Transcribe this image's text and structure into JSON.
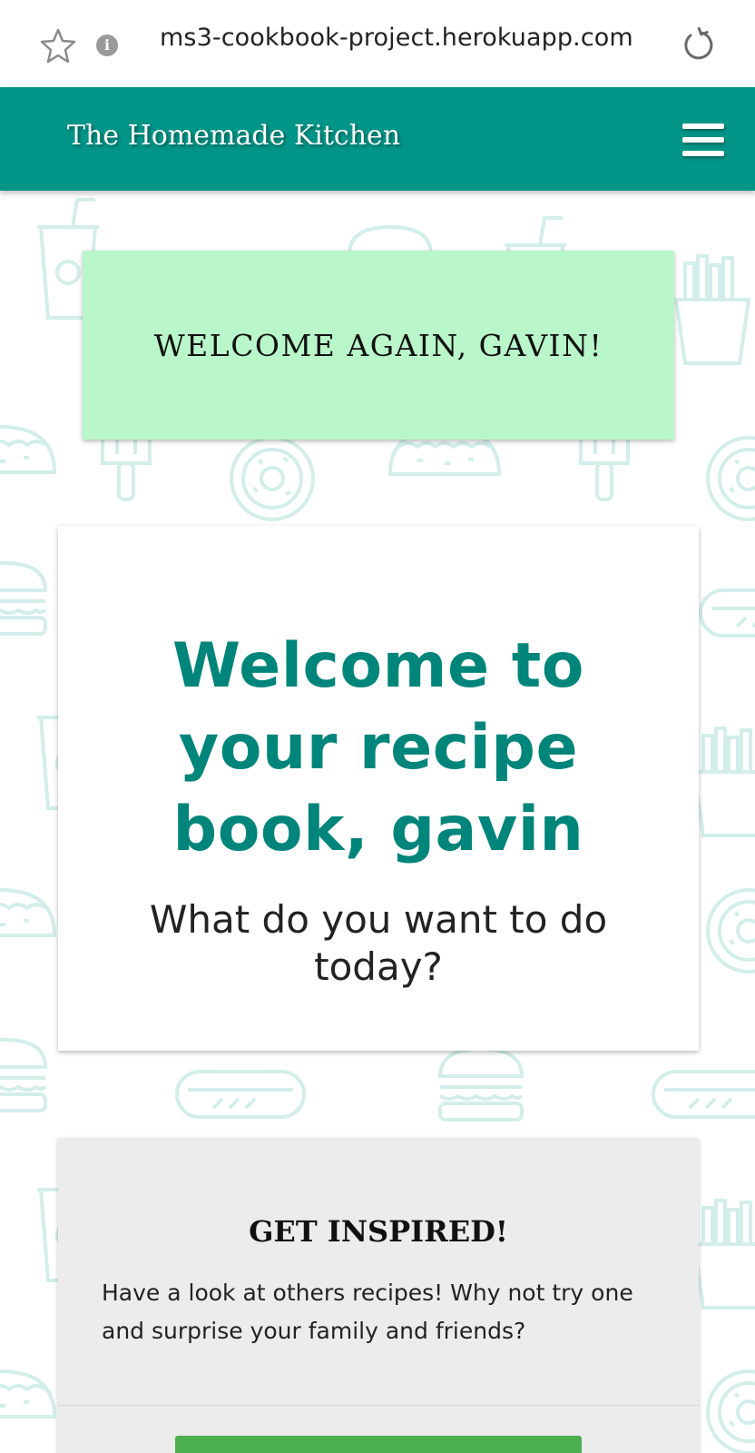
{
  "browser": {
    "url": "ms3-cookbook-project.herokuapp.com",
    "icons": [
      "star-icon",
      "info-icon",
      "reload-icon"
    ]
  },
  "navbar": {
    "brand": "The Homemade Kitchen",
    "menu_icon": "hamburger-menu-icon",
    "color": "#009587"
  },
  "welcome_banner": {
    "text": "WELCOME AGAIN, GAVIN!",
    "color": "#b9f6ca"
  },
  "welcome_card": {
    "heading": "Welcome to your recipe book, gavin",
    "subheading": "What do you want to do today?",
    "heading_color": "#00857a"
  },
  "inspire_card": {
    "title": "GET INSPIRED!",
    "text": "Have a look at others recipes! Why not try one and surprise your family and friends?",
    "button_color": "#4caf50"
  },
  "background": {
    "pattern_icons": [
      "drink-icon",
      "burger-icon",
      "fries-icon",
      "taco-icon",
      "donut-icon",
      "popsicle-icon",
      "hotdog-icon"
    ],
    "pattern_color": "#d3eeea"
  }
}
